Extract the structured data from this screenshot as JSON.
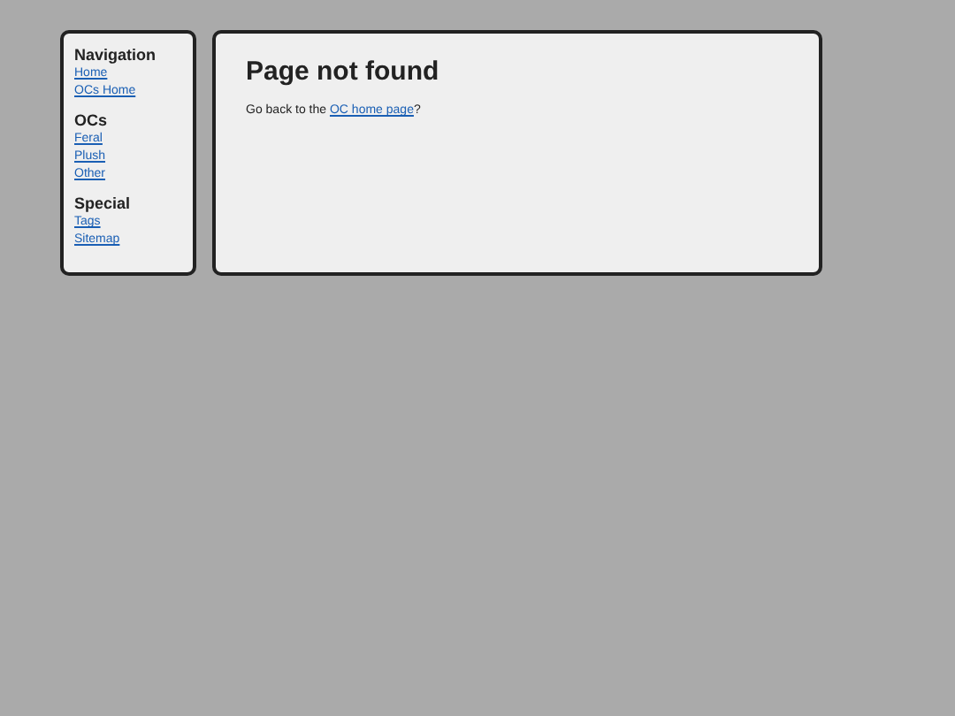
{
  "sidebar": {
    "sections": [
      {
        "heading": "Navigation",
        "links": [
          "Home",
          "OCs Home"
        ]
      },
      {
        "heading": "OCs",
        "links": [
          "Feral",
          "Plush",
          "Other"
        ]
      },
      {
        "heading": "Special",
        "links": [
          "Tags",
          "Sitemap"
        ]
      }
    ]
  },
  "main": {
    "title": "Page not found",
    "message": {
      "before": "Go back to the ",
      "link": "OC home page",
      "after": "?"
    }
  }
}
